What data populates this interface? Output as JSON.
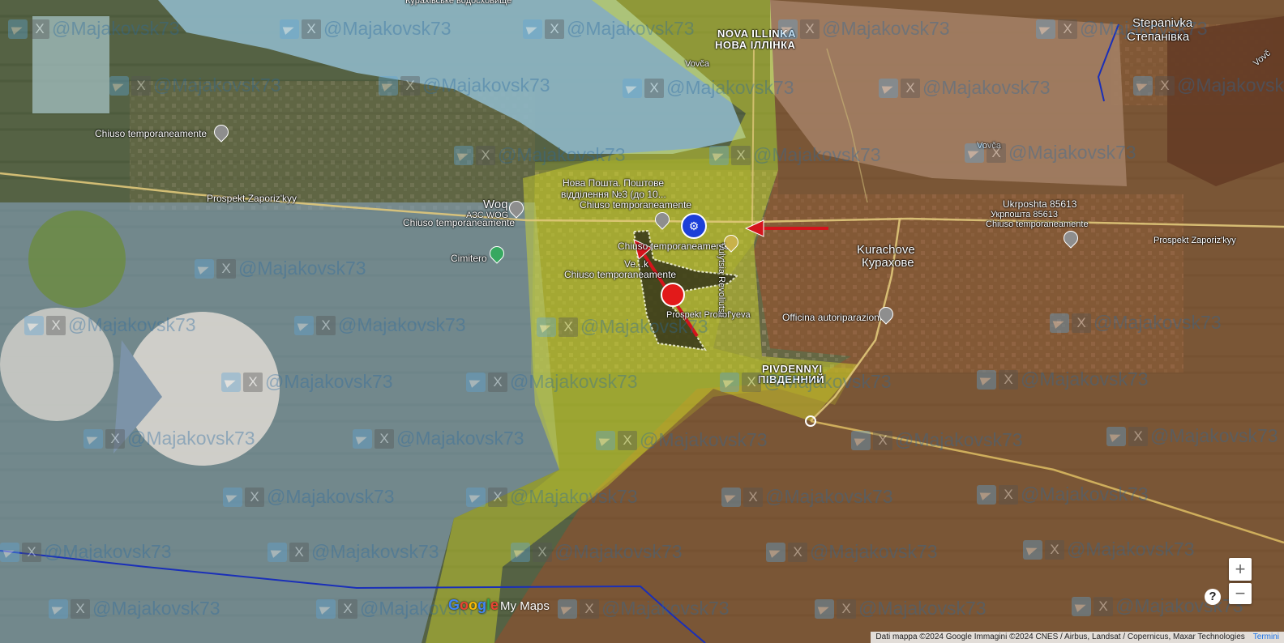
{
  "labels": {
    "reservoir": "Курахівське водосховище",
    "nova_illinka_lat": "NOVA ILLINKA",
    "nova_illinka_cyr": "НОВА ІЛЛІНКА",
    "stepanivka_lat": "Stepanivka",
    "stepanivka_cyr": "Степанівка",
    "vovcha_1": "Vovča",
    "vovcha_2": "Vovča",
    "vovcha_3": "Vovč",
    "closed_1": "Chiuso temporaneamente",
    "prospekt_zaporizkyy_w": "Prospekt Zaporiz'kyy",
    "woq": "Woq",
    "azs_woq": "АЗС WOG",
    "closed_2": "Chiuso temporaneamente",
    "cimitero": "Cimitero",
    "nova_poshta": "Нова Пошта. Поштове",
    "nova_poshta_2": "відділення №3 (до 10...",
    "closed_3": "Chiuso temporaneamente",
    "closed_4": "Chiuso temporaneamente",
    "closed_5": "Chiuso temporaneamente",
    "vershok": "Ve...k",
    "prospekt_prokofyeva": "Prospekt Prokof'yeva",
    "vulytsia_rvolutsii": "Vulytsia Revoliutsii",
    "ukrposhta_lat": "Ukrposhta 85613",
    "ukrposhta_cyr": "Укрпошта 85613",
    "closed_6": "Chiuso temporaneamente",
    "prospekt_zaporizkyy_e": "Prospekt Zaporiz'kyy",
    "kurachove_lat": "Kurachove",
    "kurachove_cyr": "Курахове",
    "officina": "Officina autoriparazioni",
    "pivdennyi_lat": "PIVDENNYI",
    "pivdennyi_cyr": "ПІВДЕННИЙ"
  },
  "watermark": "@Majakovsk73",
  "watermark_x_glyph": "X",
  "marker_icon": "factory-icon",
  "controls": {
    "zoom_in": "+",
    "zoom_out": "−",
    "help": "?"
  },
  "logo": {
    "g1": "G",
    "o1": "o",
    "o2": "o",
    "g2": "g",
    "l": "l",
    "e": "e",
    "mymaps": "My Maps"
  },
  "attribution": {
    "text": "Dati mappa ©2024 Google Immagini ©2024 CNES / Airbus, Landsat / Copernicus, Maxar Technologies",
    "terms": "Termini"
  },
  "colors": {
    "water": "#8fb8c8",
    "russian_control_overlay": "#a04a28",
    "contested_overlay": "#d8dc2a",
    "ukrainian_field": "#8aa7c8",
    "arrow": "#d4141c",
    "front_line": "#1a2fb8"
  }
}
